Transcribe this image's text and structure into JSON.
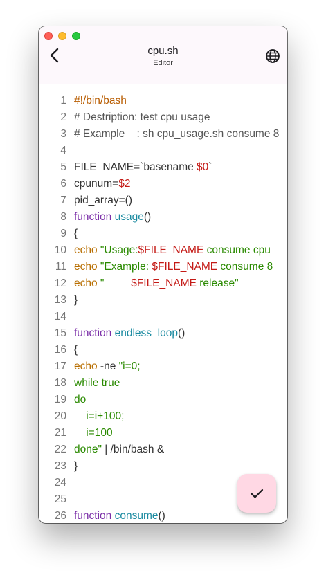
{
  "header": {
    "title": "cpu.sh",
    "subtitle": "Editor",
    "back_icon": "chevron-left-icon",
    "globe_icon": "globe-icon"
  },
  "fab": {
    "icon": "checkmark-icon",
    "color": "#ffd8e4"
  },
  "colors": {
    "keyword": "#7b2fa8",
    "function_name": "#1a8aa0",
    "builtin": "#b86e00",
    "string": "#2a8a00",
    "variable": "#c41a16"
  },
  "lines": [
    {
      "n": "1",
      "tokens": [
        {
          "t": "#!/bin/bash",
          "c": "shebang"
        }
      ]
    },
    {
      "n": "2",
      "tokens": [
        {
          "t": "# Destription: test cpu usage",
          "c": "comment"
        }
      ]
    },
    {
      "n": "3",
      "tokens": [
        {
          "t": "# Example    : sh cpu_usage.sh consume 8",
          "c": "comment"
        }
      ]
    },
    {
      "n": "4",
      "tokens": []
    },
    {
      "n": "5",
      "tokens": [
        {
          "t": "FILE_NAME=`basename ",
          "c": "plain"
        },
        {
          "t": "$0",
          "c": "var"
        },
        {
          "t": "`",
          "c": "plain"
        }
      ]
    },
    {
      "n": "6",
      "tokens": [
        {
          "t": "cpunum=",
          "c": "plain"
        },
        {
          "t": "$2",
          "c": "var"
        }
      ]
    },
    {
      "n": "7",
      "tokens": [
        {
          "t": "pid_array=()",
          "c": "plain"
        }
      ]
    },
    {
      "n": "8",
      "tokens": [
        {
          "t": "function",
          "c": "keyword"
        },
        {
          "t": " ",
          "c": "plain"
        },
        {
          "t": "usage",
          "c": "func"
        },
        {
          "t": "()",
          "c": "plain"
        }
      ]
    },
    {
      "n": "9",
      "tokens": [
        {
          "t": "{",
          "c": "plain"
        }
      ]
    },
    {
      "n": "10",
      "tokens": [
        {
          "t": "echo",
          "c": "builtin"
        },
        {
          "t": " \"Usage:",
          "c": "string"
        },
        {
          "t": "$FILE_NAME",
          "c": "var"
        },
        {
          "t": " consume cpu",
          "c": "string"
        }
      ]
    },
    {
      "n": "11",
      "tokens": [
        {
          "t": "echo",
          "c": "builtin"
        },
        {
          "t": " \"Example: ",
          "c": "string"
        },
        {
          "t": "$FILE_NAME",
          "c": "var"
        },
        {
          "t": " consume 8",
          "c": "string"
        }
      ]
    },
    {
      "n": "12",
      "tokens": [
        {
          "t": "echo",
          "c": "builtin"
        },
        {
          "t": " \"         ",
          "c": "string"
        },
        {
          "t": "$FILE_NAME",
          "c": "var"
        },
        {
          "t": " release\"",
          "c": "string"
        }
      ]
    },
    {
      "n": "13",
      "tokens": [
        {
          "t": "}",
          "c": "plain"
        }
      ]
    },
    {
      "n": "14",
      "tokens": []
    },
    {
      "n": "15",
      "tokens": [
        {
          "t": "function",
          "c": "keyword"
        },
        {
          "t": " ",
          "c": "plain"
        },
        {
          "t": "endless_loop",
          "c": "func"
        },
        {
          "t": "()",
          "c": "plain"
        }
      ]
    },
    {
      "n": "16",
      "tokens": [
        {
          "t": "{",
          "c": "plain"
        }
      ]
    },
    {
      "n": "17",
      "tokens": [
        {
          "t": "echo",
          "c": "builtin"
        },
        {
          "t": " -ne ",
          "c": "plain"
        },
        {
          "t": "\"i=0;",
          "c": "string"
        }
      ]
    },
    {
      "n": "18",
      "tokens": [
        {
          "t": "while true",
          "c": "string"
        }
      ]
    },
    {
      "n": "19",
      "tokens": [
        {
          "t": "do",
          "c": "string"
        }
      ]
    },
    {
      "n": "20",
      "tokens": [
        {
          "t": "    i=i+100;",
          "c": "string"
        }
      ]
    },
    {
      "n": "21",
      "tokens": [
        {
          "t": "    i=100",
          "c": "string"
        }
      ]
    },
    {
      "n": "22",
      "tokens": [
        {
          "t": "done\"",
          "c": "string"
        },
        {
          "t": " | /bin/bash &",
          "c": "plain"
        }
      ]
    },
    {
      "n": "23",
      "tokens": [
        {
          "t": "}",
          "c": "plain"
        }
      ]
    },
    {
      "n": "24",
      "tokens": []
    },
    {
      "n": "25",
      "tokens": []
    },
    {
      "n": "26",
      "tokens": [
        {
          "t": "function",
          "c": "keyword"
        },
        {
          "t": " ",
          "c": "plain"
        },
        {
          "t": "consume",
          "c": "func"
        },
        {
          "t": "()",
          "c": "plain"
        }
      ]
    }
  ]
}
